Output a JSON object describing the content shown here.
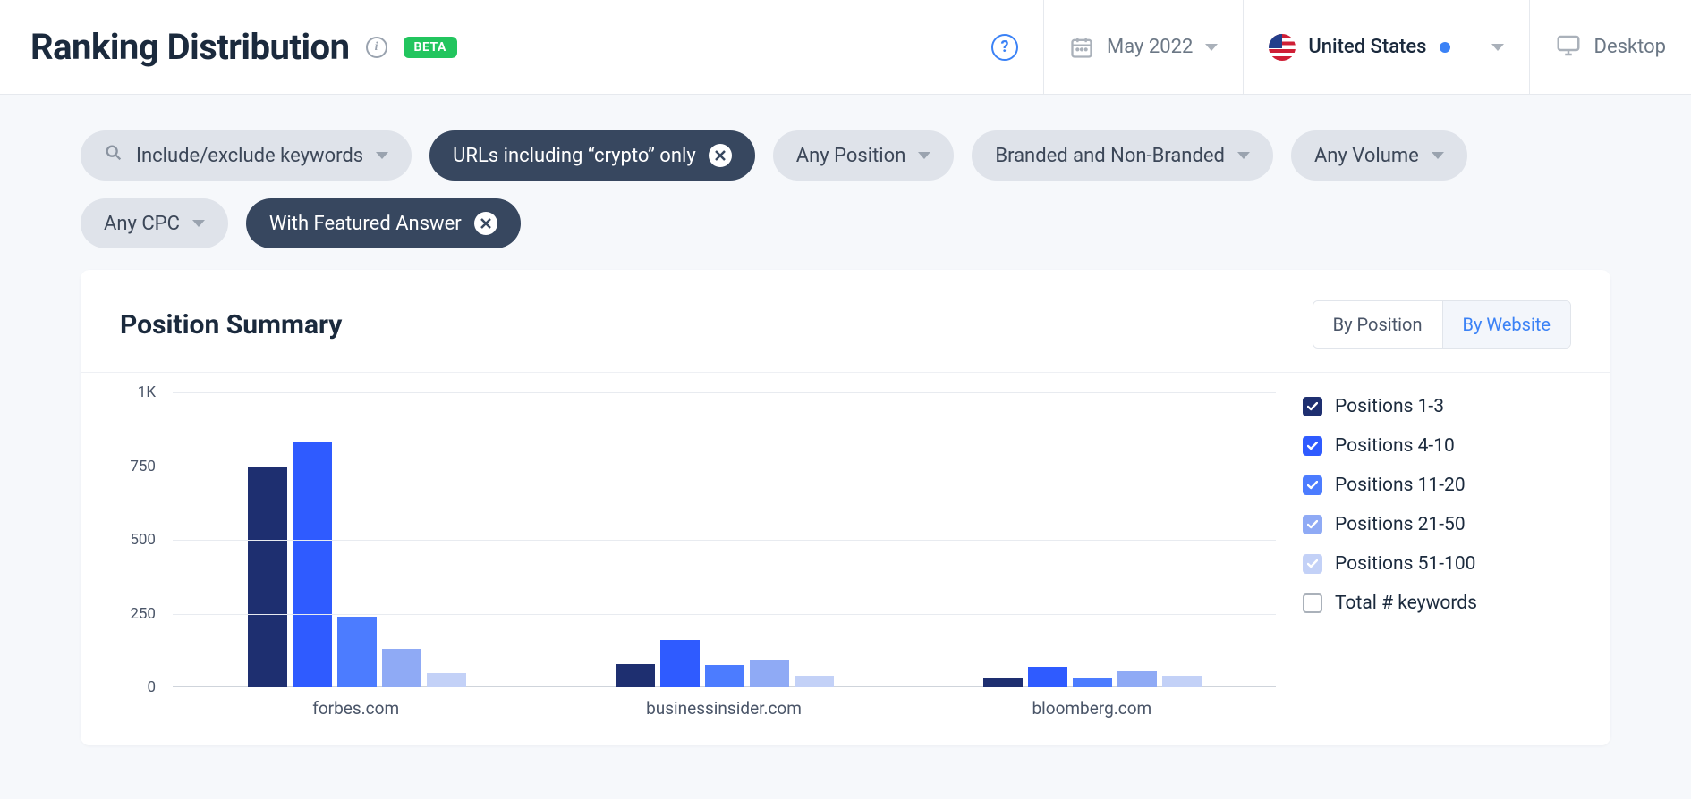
{
  "header": {
    "title": "Ranking Distribution",
    "badge": "BETA",
    "date": "May 2022",
    "country": "United States",
    "device": "Desktop"
  },
  "filters": {
    "keywords": "Include/exclude keywords",
    "urls": "URLs including “crypto” only",
    "position": "Any Position",
    "branded": "Branded and Non-Branded",
    "volume": "Any Volume",
    "cpc": "Any CPC",
    "featured": "With Featured Answer"
  },
  "card": {
    "title": "Position Summary",
    "tab_position": "By Position",
    "tab_website": "By Website"
  },
  "legend": [
    {
      "label": "Positions 1-3",
      "color": "#1e2f70",
      "checked": true,
      "soft": false
    },
    {
      "label": "Positions 4-10",
      "color": "#2f5bff",
      "checked": true,
      "soft": false
    },
    {
      "label": "Positions 11-20",
      "color": "#4c7cff",
      "checked": true,
      "soft": false
    },
    {
      "label": "Positions 21-50",
      "color": "#8faaf5",
      "checked": true,
      "soft": true
    },
    {
      "label": "Positions 51-100",
      "color": "#c3d1f7",
      "checked": true,
      "soft": true
    },
    {
      "label": "Total # keywords",
      "color": "",
      "checked": false,
      "soft": false
    }
  ],
  "chart_data": {
    "type": "bar",
    "title": "Position Summary",
    "xlabel": "",
    "ylabel": "",
    "ylim": [
      0,
      1000
    ],
    "yticks": [
      0,
      250,
      500,
      750,
      "1K"
    ],
    "categories": [
      "forbes.com",
      "businessinsider.com",
      "bloomberg.com"
    ],
    "series": [
      {
        "name": "Positions 1-3",
        "color": "#1e2f70",
        "values": [
          750,
          80,
          30
        ]
      },
      {
        "name": "Positions 4-10",
        "color": "#2f5bff",
        "values": [
          830,
          160,
          70
        ]
      },
      {
        "name": "Positions 11-20",
        "color": "#4c7cff",
        "values": [
          240,
          75,
          30
        ]
      },
      {
        "name": "Positions 21-50",
        "color": "#8faaf5",
        "values": [
          130,
          90,
          55
        ]
      },
      {
        "name": "Positions 51-100",
        "color": "#c3d1f7",
        "values": [
          50,
          40,
          40
        ]
      }
    ]
  }
}
